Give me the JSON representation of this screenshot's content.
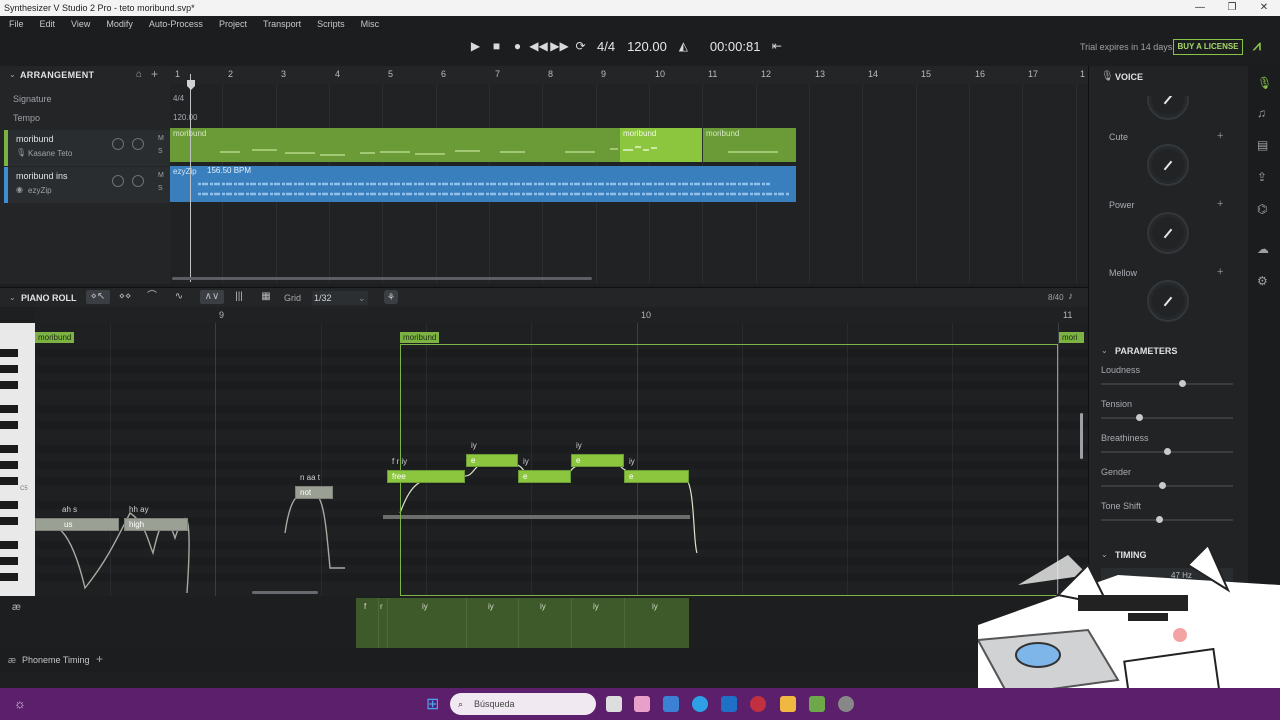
{
  "window": {
    "title": "Synthesizer V Studio 2 Pro - teto moribund.svp*"
  },
  "menu": [
    "File",
    "Edit",
    "View",
    "Modify",
    "Auto-Process",
    "Project",
    "Transport",
    "Scripts",
    "Misc"
  ],
  "transport": {
    "time_signature": "4/4",
    "tempo": "120.00",
    "time": "00:00:81"
  },
  "license": {
    "trial": "Trial expires in 14 days",
    "buy": "BUY A LICENSE"
  },
  "arrangement": {
    "title": "ARRANGEMENT",
    "ruler": [
      "1",
      "2",
      "3",
      "4",
      "5",
      "6",
      "7",
      "8",
      "9",
      "10",
      "11",
      "12",
      "13",
      "14",
      "15",
      "16",
      "17",
      "1"
    ],
    "signature_label": "Signature",
    "signature_value": "4/4",
    "tempo_label": "Tempo",
    "tempo_value": "120.00",
    "tracks": [
      {
        "name": "moribund",
        "voice": "Kasane Teto",
        "clips": [
          "moribund",
          "moribund",
          "moribund"
        ]
      },
      {
        "name": "moribund ins",
        "voice": "ezyZip",
        "clip": "ezyZip",
        "bpm": "156.50 BPM"
      }
    ],
    "mute": "M",
    "solo": "S"
  },
  "piano_roll": {
    "title": "PIANO ROLL",
    "grid_label": "Grid",
    "grid_value": "1/32",
    "count": "8/40",
    "ruler": [
      "9",
      "10",
      "11"
    ],
    "group_labels": [
      "moribund",
      "moribund",
      "mori"
    ],
    "c5": "C5",
    "notes": [
      {
        "lyric": "us",
        "phonemes": "ah s"
      },
      {
        "lyric": "high",
        "phonemes": "hh ay"
      },
      {
        "lyric": "not",
        "phonemes": "n aa t"
      },
      {
        "lyric": "free",
        "phonemes": "f r iy"
      },
      {
        "lyric": "e",
        "phonemes": "iy"
      },
      {
        "lyric": "e",
        "phonemes": "iy"
      },
      {
        "lyric": "e",
        "phonemes": "iy"
      },
      {
        "lyric": "e",
        "phonemes": "iy"
      }
    ],
    "phoneme_lane": [
      "f",
      "r",
      "iy",
      "iy",
      "iy",
      "iy",
      "iy"
    ],
    "bottom_tab": "Phoneme Timing"
  },
  "voice_panel": {
    "title": "VOICE",
    "dials": [
      "Cute",
      "Power",
      "Mellow"
    ],
    "parameters_title": "PARAMETERS",
    "parameters": [
      {
        "name": "Loudness",
        "value": 0.62
      },
      {
        "name": "Tension",
        "value": 0.28
      },
      {
        "name": "Breathiness",
        "value": 0.5
      },
      {
        "name": "Gender",
        "value": 0.46
      },
      {
        "name": "Tone Shift",
        "value": 0.44
      }
    ],
    "timing_title": "TIMING",
    "hz": "47 Hz",
    "ents": "ents"
  },
  "taskbar": {
    "search": "Búsqueda"
  }
}
